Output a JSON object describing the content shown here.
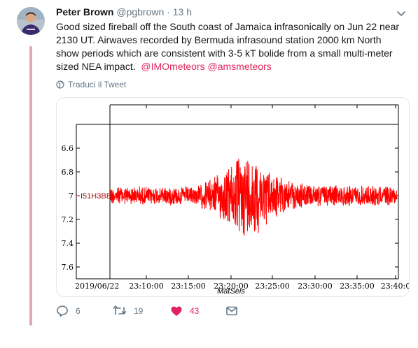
{
  "tweet": {
    "author_name": "Peter Brown",
    "author_handle": "@pgbrown",
    "separator": "·",
    "time": "13 h",
    "text_main": "Good sized fireball off the South coast of Jamaica infrasonically on Jun 22 near 2130 UT. Airwaves recorded by Bermuda infrasound station 2000 km North show periods which are consistent with 3-5 kT bolide from a small multi-meter sized NEA impact.",
    "mention_1": "@IMOmeteors",
    "mention_2": "@amsmeteors",
    "translate_label": "Traduci il Tweet",
    "actions": {
      "reply_count": "6",
      "retweet_count": "19",
      "like_count": "43"
    },
    "colors": {
      "accent_like": "#e0245e",
      "muted": "#657786",
      "thread_line": "#e0aab3"
    }
  },
  "chart_data": {
    "type": "line",
    "series": [
      {
        "name": "I51H3BB",
        "color": "#ff0000"
      }
    ],
    "station_label": "I51H3BB",
    "y_ticks": [
      "6.6",
      "6.8",
      "7",
      "7.2",
      "7.4",
      "7.6"
    ],
    "ylim": [
      7.7,
      6.4
    ],
    "x_ticks": [
      "2019/06/22",
      "23:10:00",
      "23:15:00",
      "23:20:00",
      "23:25:00",
      "23:30:00",
      "23:35:00",
      "23:40:0"
    ],
    "xlabel": "MatSeis",
    "center": 7.0,
    "envelope": [
      {
        "t": 0.0,
        "a": 0.065
      },
      {
        "t": 0.3,
        "a": 0.07
      },
      {
        "t": 0.38,
        "a": 0.16
      },
      {
        "t": 0.42,
        "a": 0.23
      },
      {
        "t": 0.45,
        "a": 0.29
      },
      {
        "t": 0.48,
        "a": 0.33
      },
      {
        "t": 0.52,
        "a": 0.27
      },
      {
        "t": 0.56,
        "a": 0.18
      },
      {
        "t": 0.62,
        "a": 0.11
      },
      {
        "t": 0.7,
        "a": 0.08
      },
      {
        "t": 0.85,
        "a": 0.075
      },
      {
        "t": 1.0,
        "a": 0.07
      }
    ]
  }
}
